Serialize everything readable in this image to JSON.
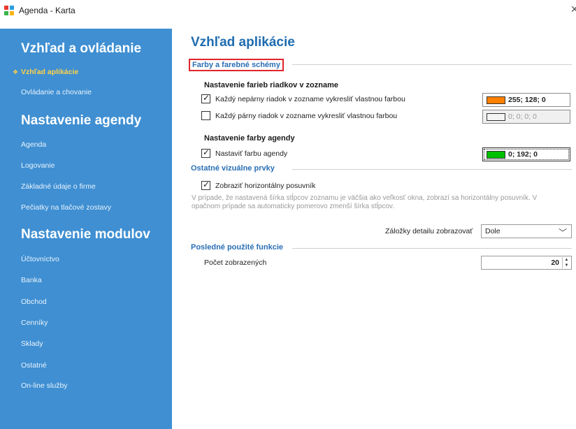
{
  "window": {
    "title": "Agenda - Karta"
  },
  "sidebar": {
    "groups": [
      {
        "heading": "Vzhľad a ovládanie",
        "items": [
          {
            "label": "Vzhľad aplikácie",
            "active": true
          },
          {
            "label": "Ovládanie a chovanie"
          }
        ]
      },
      {
        "heading": "Nastavenie agendy",
        "items": [
          {
            "label": "Agenda"
          },
          {
            "label": "Logovanie"
          },
          {
            "label": "Základné údaje o firme"
          },
          {
            "label": "Pečiatky na tlačové zostavy"
          }
        ]
      },
      {
        "heading": "Nastavenie modulov",
        "items": [
          {
            "label": "Účtovníctvo"
          },
          {
            "label": "Banka"
          },
          {
            "label": "Obchod"
          },
          {
            "label": "Cenníky"
          },
          {
            "label": "Sklady"
          },
          {
            "label": "Ostatné"
          },
          {
            "label": "On-line služby"
          }
        ]
      }
    ],
    "active_marker": "❖"
  },
  "main": {
    "title": "Vzhľad aplikácie",
    "colors_section": {
      "label": "Farby a farebné schémy",
      "rows_heading": "Nastavenie farieb riadkov v zozname",
      "odd_row": {
        "label": "Každý nepárny riadok v zozname vykresliť vlastnou farbou",
        "checked": true,
        "color_value": "255; 128; 0",
        "swatch": "#ff8000"
      },
      "even_row": {
        "label": "Každý párny riadok v zozname vykresliť vlastnou farbou",
        "checked": false,
        "color_value": "0; 0; 0; 0",
        "swatch": "#f4f4f4"
      },
      "agenda_heading": "Nastavenie farby agendy",
      "agenda_color": {
        "label": "Nastaviť farbu agendy",
        "checked": true,
        "color_value": "0; 192; 0",
        "swatch": "#00c000"
      }
    },
    "visual_section": {
      "label": "Ostatné vizuálne prvky",
      "scrollbar": {
        "label": "Zobraziť horizontálny posuvník",
        "checked": true
      },
      "help": "V prípade, že nastavená šírka stĺpcov zoznamu je väčšia ako veľkosť okna, zobrazí sa horizontálny posuvník. V opačnom prípade sa automaticky pomerovo zmenší šírka stĺpcov.",
      "tabs_label": "Záložky detailu zobrazovať",
      "tabs_value": "Dole"
    },
    "recent_section": {
      "label": "Posledné použité funkcie",
      "count_label": "Počet zobrazených",
      "count_value": "20"
    }
  },
  "colors": {
    "sidebar_bg": "#3f8fd2",
    "accent_blue": "#2a6fb5",
    "highlight_box": "#e0262b",
    "active_item": "#ffd24a"
  }
}
